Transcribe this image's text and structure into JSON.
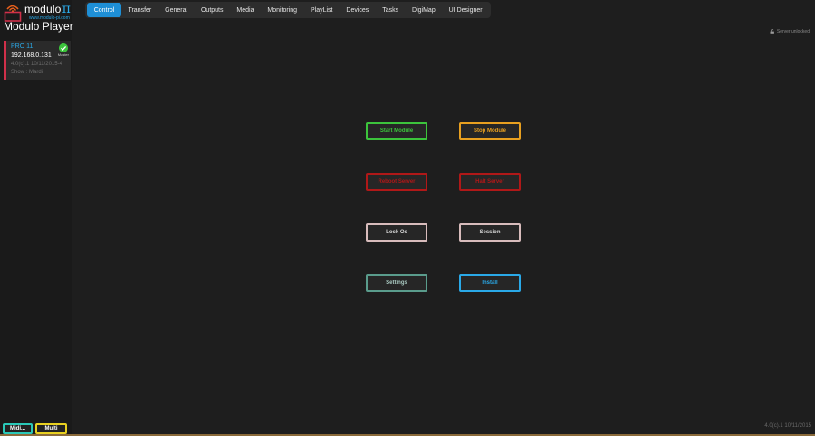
{
  "brand": {
    "name": "modulo",
    "pi": "π",
    "url": "www.modulo-pi.com"
  },
  "app_title": "Modulo Player",
  "server": {
    "name": "PRO 11",
    "ip": "192.168.0.131",
    "version": "4.0(c).1 10/11/2015-4",
    "show": "Show : Mardi",
    "role": "Master",
    "status_color": "#3cc43c",
    "accent_color": "#d0304a"
  },
  "tabs": [
    {
      "label": "Control",
      "active": true
    },
    {
      "label": "Transfer"
    },
    {
      "label": "General"
    },
    {
      "label": "Outputs"
    },
    {
      "label": "Media"
    },
    {
      "label": "Monitoring"
    },
    {
      "label": "PlayList"
    },
    {
      "label": "Devices"
    },
    {
      "label": "Tasks"
    },
    {
      "label": "DigiMap"
    },
    {
      "label": "UI Designer"
    }
  ],
  "lock_status": "Server unlocked",
  "controls": {
    "start_module": {
      "label": "Start Module",
      "color": "#3cc43c"
    },
    "stop_module": {
      "label": "Stop Module",
      "color": "#e8a020"
    },
    "reboot_server": {
      "label": "Reboot Server",
      "color": "#b01818"
    },
    "halt_server": {
      "label": "Halt Server",
      "color": "#b01818"
    },
    "lock_os": {
      "label": "Lock Os",
      "color": "#d8bcbc"
    },
    "session": {
      "label": "Session",
      "color": "#d8bcbc"
    },
    "settings": {
      "label": "Settings",
      "color": "#5a9c8c"
    },
    "install": {
      "label": "Install",
      "color": "#2aa9e8"
    }
  },
  "footer": {
    "midi": {
      "label": "Midi...",
      "color": "#2ac8b8"
    },
    "multi": {
      "label": "Multi",
      "color": "#e8d020"
    }
  },
  "version": "4.0(c).1 10/11/2015"
}
